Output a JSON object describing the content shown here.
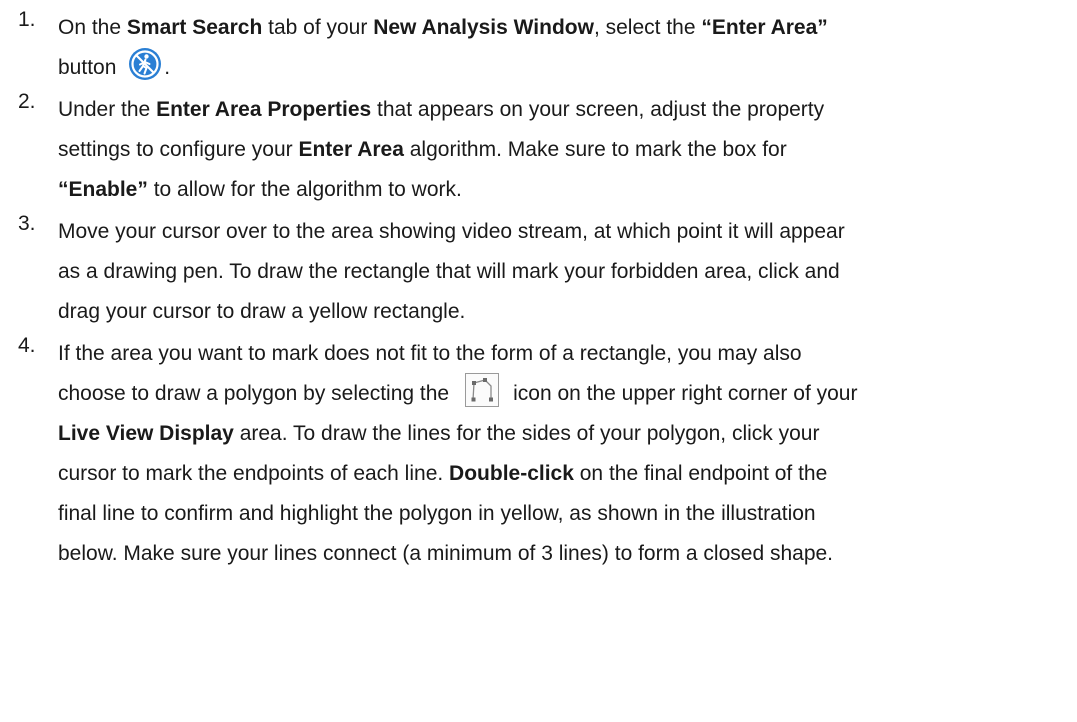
{
  "steps": [
    {
      "number": "1.",
      "lines": [
        [
          {
            "t": "On the "
          },
          {
            "t": "Smart Search",
            "b": true
          },
          {
            "t": " tab of your "
          },
          {
            "t": "New Analysis Window",
            "b": true
          },
          {
            "t": ", select the "
          },
          {
            "t": "“Enter Area”",
            "b": true
          }
        ],
        [
          {
            "t": "button "
          },
          {
            "icon": "enter-area-icon"
          },
          {
            "t": "."
          }
        ]
      ]
    },
    {
      "number": "2.",
      "lines": [
        [
          {
            "t": "Under the "
          },
          {
            "t": "Enter Area Properties",
            "b": true
          },
          {
            "t": " that appears on your screen, adjust the property"
          }
        ],
        [
          {
            "t": "settings to configure your "
          },
          {
            "t": "Enter Area",
            "b": true
          },
          {
            "t": " algorithm. Make sure to mark the box for"
          }
        ],
        [
          {
            "t": "“Enable”",
            "b": true
          },
          {
            "t": " to allow for the algorithm to work."
          }
        ]
      ]
    },
    {
      "number": "3.",
      "lines": [
        [
          {
            "t": "Move your cursor over to the area showing video stream, at which point it will appear"
          }
        ],
        [
          {
            "t": "as a drawing pen. To draw the rectangle that will mark your forbidden area, click and"
          }
        ],
        [
          {
            "t": "drag your cursor to draw a yellow rectangle."
          }
        ]
      ]
    },
    {
      "number": "4.",
      "lines": [
        [
          {
            "t": "If the area you want to mark does not fit to the form of a rectangle, you may also"
          }
        ],
        [
          {
            "t": "choose to draw a polygon by selecting the"
          },
          {
            "icon": "polygon-tool-icon"
          },
          {
            "t": "icon on the upper right corner of your"
          }
        ],
        [
          {
            "t": "Live View Display",
            "b": true
          },
          {
            "t": " area. To draw the lines for the sides of your polygon, click your"
          }
        ],
        [
          {
            "t": "cursor to mark the endpoints of each line. "
          },
          {
            "t": "Double-click",
            "b": true
          },
          {
            "t": " on the final endpoint of the"
          }
        ],
        [
          {
            "t": "final line to confirm and highlight the polygon in yellow, as shown in the illustration"
          }
        ],
        [
          {
            "t": "below. Make sure your lines connect (a minimum of 3 lines) to form a closed shape."
          }
        ]
      ]
    }
  ],
  "icons": {
    "enter-area-icon": {
      "fill": "#2a7fd4",
      "ring": "#ffffff",
      "glyph": "#ffffff"
    },
    "polygon-tool-icon": {
      "border": "#9a9a9a",
      "line": "#8a8a8a",
      "node": "#6a6a6a"
    }
  }
}
